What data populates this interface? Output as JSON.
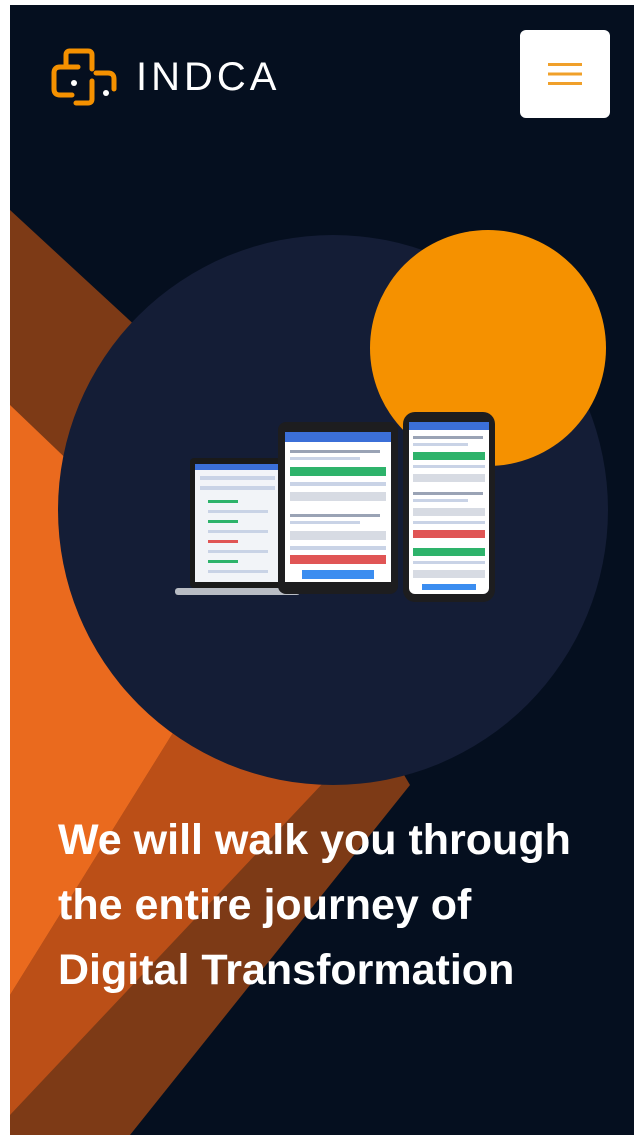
{
  "header": {
    "brand": "INDCA",
    "logo_icon": "indca-logo-mark",
    "menu_icon": "hamburger-icon"
  },
  "hero": {
    "headline": "We will walk you through the entire journey of Digital Transformation",
    "illustration_icon": "multi-device-mockup"
  },
  "colors": {
    "background": "#050f1f",
    "circle_navy": "#141d36",
    "accent_orange": "#f59100",
    "orange_stripe": "#ea6a1e",
    "orange_dark": "#7d3a16",
    "menu_icon": "#f0a02a",
    "white": "#ffffff"
  }
}
